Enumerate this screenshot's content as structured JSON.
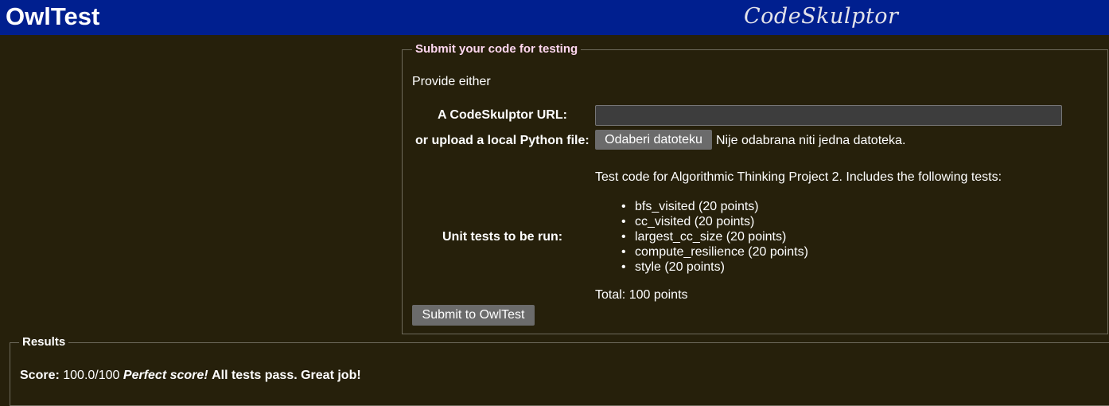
{
  "header": {
    "app_title": "OwlTest",
    "brand": "CodeSkulptor",
    "background_color": "#001f8f"
  },
  "submit_panel": {
    "legend": "Submit your code for testing",
    "intro": "Provide either",
    "url_label": "A CodeSkulptor URL:",
    "url_value": "",
    "upload_label": "or upload a local Python file:",
    "file_button_label": "Odaberi datoteku",
    "file_status": "Nije odabrana niti jedna datoteka.",
    "unit_tests_label": "Unit tests to be run:",
    "tests_description": "Test code for Algorithmic Thinking Project 2. Includes the following tests:",
    "tests": [
      "bfs_visited (20 points)",
      "cc_visited (20 points)",
      "largest_cc_size (20 points)",
      "compute_resilience (20 points)",
      "style (20 points)"
    ],
    "total": "Total: 100 points",
    "submit_button_label": "Submit to OwlTest"
  },
  "results": {
    "legend": "Results",
    "score_label": "Score:",
    "score_value": "100.0/100",
    "perfect_text": "Perfect score!",
    "message": "All tests pass. Great job!"
  },
  "colors": {
    "page_background": "#26200b",
    "legend_accent": "#ffd7f0",
    "button_background": "#6b6b6b"
  }
}
